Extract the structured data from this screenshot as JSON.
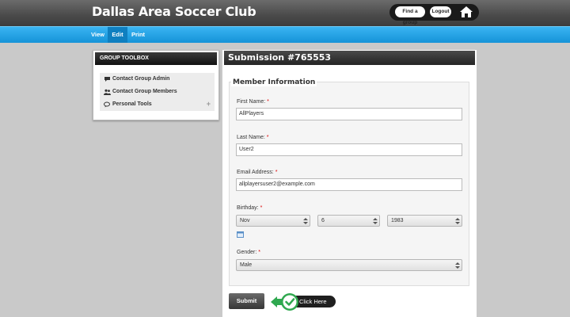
{
  "header": {
    "site_title": "Dallas Area Soccer Club",
    "find_group_label": "Find a group",
    "logout_label": "Logout",
    "home_icon": "home-icon"
  },
  "nav": {
    "items": [
      {
        "label": "View",
        "active": false
      },
      {
        "label": "Edit",
        "active": true
      },
      {
        "label": "Print",
        "active": false
      }
    ]
  },
  "sidebar": {
    "title": "GROUP TOOLBOX",
    "items": [
      {
        "label": "Contact Group Admin",
        "icon": "speech-bubble-icon"
      },
      {
        "label": "Contact Group Members",
        "icon": "users-icon"
      },
      {
        "label": "Personal Tools",
        "icon": "chat-icon",
        "expand": "+"
      }
    ]
  },
  "main": {
    "title": "Submission #765553",
    "section_title": "Member Information",
    "required_marker": "*",
    "first_name": {
      "label": "First Name:",
      "value": "AllPlayers"
    },
    "last_name": {
      "label": "Last Name:",
      "value": "User2"
    },
    "email": {
      "label": "Email Address:",
      "value": "allplayersuser2@example.com"
    },
    "birthday": {
      "label": "Birthday:",
      "month": "Nov",
      "day": "6",
      "year": "1983",
      "calendar_icon": "calendar-icon"
    },
    "gender": {
      "label": "Gender:",
      "value": "Male"
    },
    "submit_label": "Submit",
    "click_here_label": "Click Here"
  },
  "colors": {
    "nav_blue": "#1a9be0",
    "nav_active": "#0f7fc0",
    "required_red": "#dd0000",
    "callout_green": "#2fa84f"
  }
}
